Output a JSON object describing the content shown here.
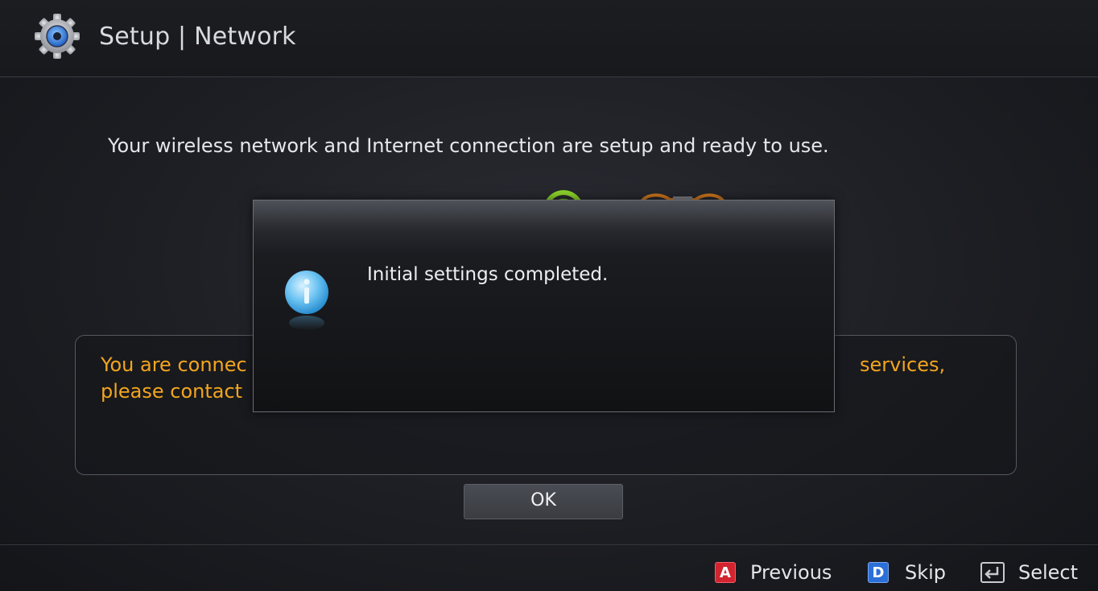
{
  "header": {
    "title": "Setup | Network",
    "icon": "gear-icon"
  },
  "main": {
    "message": "Your wireless network and Internet connection are setup and ready to use.",
    "panel": {
      "line1_left": "You are connec",
      "line1_right": "services,",
      "line2_left": "please contact"
    },
    "ok_label": "OK"
  },
  "dialog": {
    "icon": "info-icon",
    "text": "Initial settings completed."
  },
  "footer": {
    "keys": [
      {
        "badge": "A",
        "label": "Previous",
        "color": "#d1242f"
      },
      {
        "badge": "D",
        "label": "Skip",
        "color": "#2b6fd8"
      },
      {
        "badge": "enter-icon",
        "label": "Select"
      }
    ]
  },
  "colors": {
    "accent_text": "#f3a51e",
    "background": "#1b1c20"
  }
}
